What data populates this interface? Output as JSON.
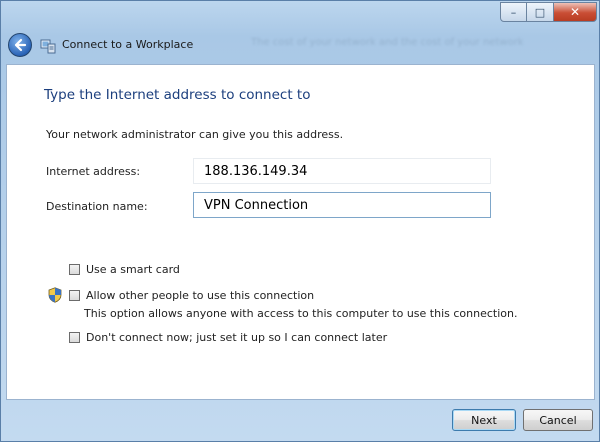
{
  "window": {
    "title": "Connect to a Workplace",
    "title_bg_text": "The cost of your network and the cost of your network",
    "controls": {
      "minimize": "–",
      "maximize": "□",
      "close": "✕"
    },
    "colors": {
      "heading": "#1c3f7e",
      "frame": "#b3cfeb",
      "close": "#c94e35"
    }
  },
  "header": {
    "heading": "Type the Internet address to connect to"
  },
  "form": {
    "description": "Your network administrator can give you this address.",
    "internet_address_label": "Internet address:",
    "internet_address_value": "188.136.149.34",
    "destination_name_label": "Destination name:",
    "destination_name_value": "VPN Connection"
  },
  "options": {
    "smart_card": "Use a smart card",
    "allow_others": "Allow other people to use this connection",
    "allow_others_note": "This option allows anyone with access to this computer to use this connection.",
    "dont_connect": "Don't connect now; just set it up so I can connect later"
  },
  "icons": {
    "back": "back-arrow-icon",
    "window": "network-window-icon",
    "shield": "uac-shield-icon"
  },
  "footer": {
    "next": "Next",
    "cancel": "Cancel"
  }
}
